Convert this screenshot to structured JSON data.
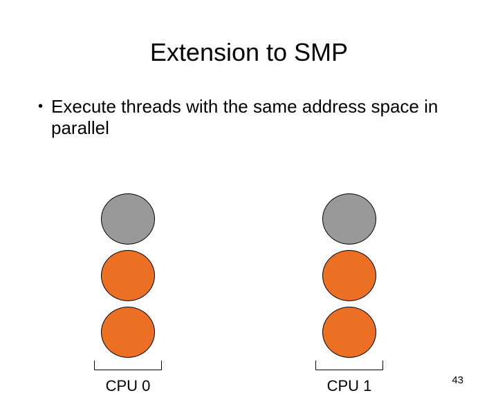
{
  "title": "Extension to SMP",
  "bullet": {
    "marker": "•",
    "text": "Execute threads with the same address space in parallel"
  },
  "diagram": {
    "columns": [
      {
        "label": "CPU 0",
        "balls": [
          {
            "color": "#999999",
            "kind": "gray"
          },
          {
            "color": "#ec7024",
            "kind": "orange"
          },
          {
            "color": "#ec7024",
            "kind": "orange"
          }
        ]
      },
      {
        "label": "CPU 1",
        "balls": [
          {
            "color": "#999999",
            "kind": "gray"
          },
          {
            "color": "#ec7024",
            "kind": "orange"
          },
          {
            "color": "#ec7024",
            "kind": "orange"
          }
        ]
      }
    ]
  },
  "page_number": "43"
}
